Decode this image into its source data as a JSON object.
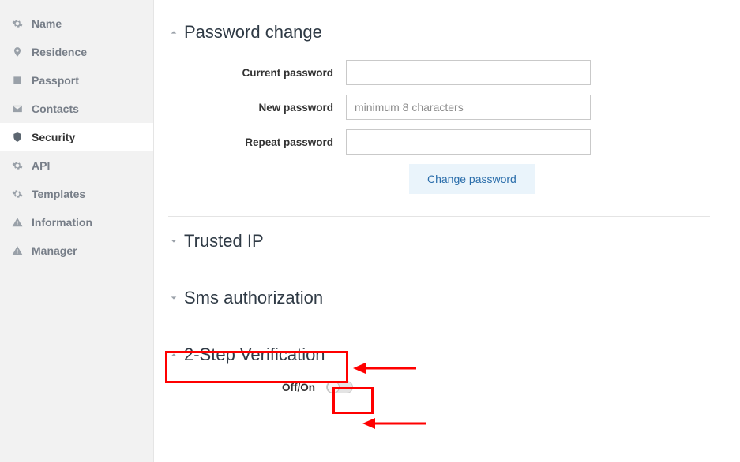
{
  "sidebar": {
    "items": [
      {
        "label": "Name",
        "icon": "gear-icon"
      },
      {
        "label": "Residence",
        "icon": "pin-icon"
      },
      {
        "label": "Passport",
        "icon": "id-icon"
      },
      {
        "label": "Contacts",
        "icon": "mail-icon"
      },
      {
        "label": "Security",
        "icon": "shield-icon"
      },
      {
        "label": "API",
        "icon": "gear-icon"
      },
      {
        "label": "Templates",
        "icon": "gear-icon"
      },
      {
        "label": "Information",
        "icon": "warning-icon"
      },
      {
        "label": "Manager",
        "icon": "warning-icon"
      }
    ],
    "active_index": 4
  },
  "sections": {
    "password_change": {
      "title": "Password change",
      "expanded": true,
      "fields": {
        "current": {
          "label": "Current password",
          "value": ""
        },
        "new": {
          "label": "New password",
          "value": "",
          "placeholder": "minimum 8 characters"
        },
        "repeat": {
          "label": "Repeat password",
          "value": ""
        }
      },
      "button": "Change password"
    },
    "trusted_ip": {
      "title": "Trusted IP",
      "expanded": false
    },
    "sms_auth": {
      "title": "Sms authorization",
      "expanded": false
    },
    "two_step": {
      "title": "2-Step Verification",
      "expanded": true,
      "toggle_label": "Off/On",
      "toggle_state": false
    }
  },
  "annotations": {
    "highlight_two_step_header": true,
    "highlight_two_step_toggle": true
  }
}
